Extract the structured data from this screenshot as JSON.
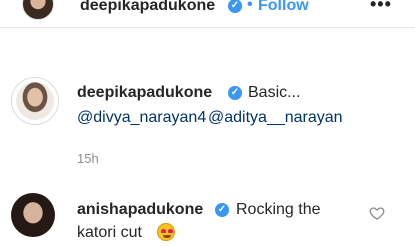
{
  "header": {
    "username": "deepikapadukone",
    "separator": "•",
    "follow_label": "Follow",
    "more_label": "•••"
  },
  "caption": {
    "username": "deepikapadukone",
    "text": "Basic...",
    "mentions": [
      "@divya_narayan4",
      "@aditya__narayan"
    ],
    "time": "15h"
  },
  "comment": {
    "username": "anishapadukone",
    "text_line1": "Rocking the",
    "text_line2": "katori cut"
  },
  "icons": {
    "verified": "verified-badge-icon",
    "heart": "heart-outline-icon",
    "emoji": "heart-eyes-emoji-icon"
  },
  "colors": {
    "link_blue": "#3897f0",
    "mention": "#003569",
    "muted": "#8e8e8e"
  }
}
